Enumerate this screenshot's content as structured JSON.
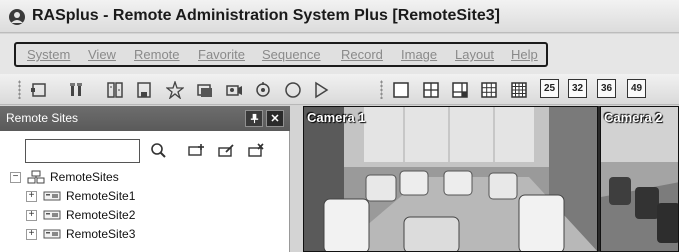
{
  "window": {
    "title": "RASplus - Remote Administration System Plus [RemoteSite3]",
    "icon": "rasplus-app-icon"
  },
  "menu": {
    "items": [
      "System",
      "View",
      "Remote",
      "Favorite",
      "Sequence",
      "Record",
      "Image",
      "Layout",
      "Help"
    ]
  },
  "toolbar": {
    "icons": [
      "screen-icon",
      "tools-icon",
      "settings-icon",
      "save-icon",
      "favorite-star-icon",
      "window-icon",
      "camera-icon",
      "ptz-icon",
      "record-circle-icon",
      "play-icon",
      "layout-1-icon",
      "layout-4-icon",
      "layout-6-icon",
      "layout-9-icon",
      "layout-16-icon"
    ],
    "layout_numbers": [
      "25",
      "32",
      "36",
      "49"
    ]
  },
  "panel": {
    "title": "Remote Sites",
    "pin": "ᵽ",
    "close": "✕",
    "search_value": "",
    "tree": {
      "root": "RemoteSites",
      "children": [
        "RemoteSite1",
        "RemoteSite2",
        "RemoteSite3"
      ]
    }
  },
  "cameras": [
    {
      "label": "Camera 1"
    },
    {
      "label": "Camera 2"
    }
  ],
  "colors": {
    "panel_header": "#636363",
    "menu_frame": "#1b1b1b",
    "menu_text": "#8a8a8a"
  }
}
